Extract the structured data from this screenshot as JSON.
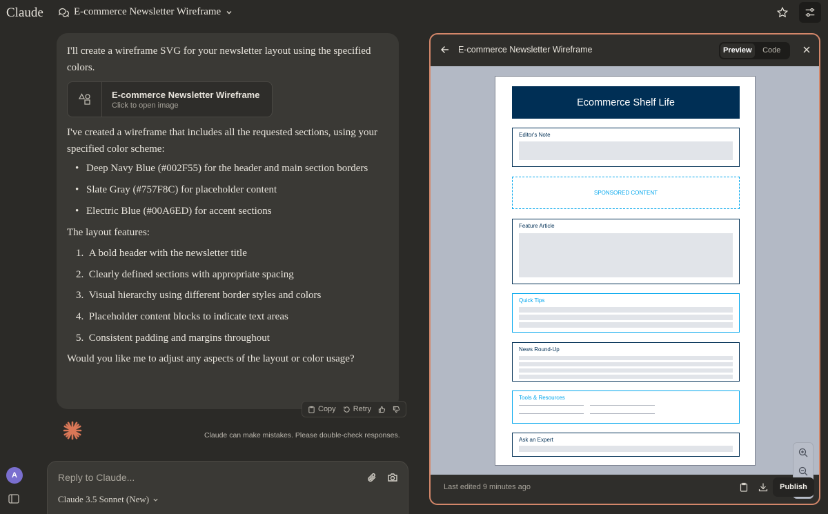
{
  "app": {
    "logo": "Claude"
  },
  "header": {
    "conversation_title": "E-commerce Newsletter Wireframe"
  },
  "message": {
    "intro": "I'll create a wireframe SVG for your newsletter layout using the specified colors.",
    "artifact_card": {
      "title": "E-commerce Newsletter Wireframe",
      "subtitle": "Click to open image"
    },
    "summary": "I've created a wireframe that includes all the requested sections, using your specified color scheme:",
    "colors": [
      "Deep Navy Blue (#002F55) for the header and main section borders",
      "Slate Gray (#757F8C) for placeholder content",
      "Electric Blue (#00A6ED) for accent sections"
    ],
    "layout_heading": "The layout features:",
    "features": [
      {
        "n": "1.",
        "text": "A bold header with the newsletter title"
      },
      {
        "n": "2.",
        "text": "Clearly defined sections with appropriate spacing"
      },
      {
        "n": "3.",
        "text": "Visual hierarchy using different border styles and colors"
      },
      {
        "n": "4.",
        "text": "Placeholder content blocks to indicate text areas"
      },
      {
        "n": "5.",
        "text": "Consistent padding and margins throughout"
      }
    ],
    "closing": "Would you like me to adjust any aspects of the layout or color usage?"
  },
  "message_actions": {
    "copy": "Copy",
    "retry": "Retry"
  },
  "disclaimer": "Claude can make mistakes. Please double-check responses.",
  "user": {
    "avatar_initial": "A"
  },
  "composer": {
    "placeholder": "Reply to Claude...",
    "model": "Claude 3.5 Sonnet (New)"
  },
  "artifact": {
    "title": "E-commerce Newsletter Wireframe",
    "tabs": {
      "preview": "Preview",
      "code": "Code"
    },
    "last_edited": "Last edited 9 minutes ago",
    "publish": "Publish",
    "newsletter": {
      "title": "Ecommerce Shelf Life",
      "sections": {
        "editors_note": "Editor's Note",
        "sponsored": "SPONSORED CONTENT",
        "feature": "Feature Article",
        "quick_tips": "Quick Tips",
        "news": "News Round-Up",
        "tools": "Tools & Resources",
        "expert": "Ask an Expert"
      }
    }
  },
  "colors": {
    "navy": "#002F55",
    "slate": "#757F8C",
    "electric": "#00A6ED",
    "accent_border": "#d4876a"
  }
}
